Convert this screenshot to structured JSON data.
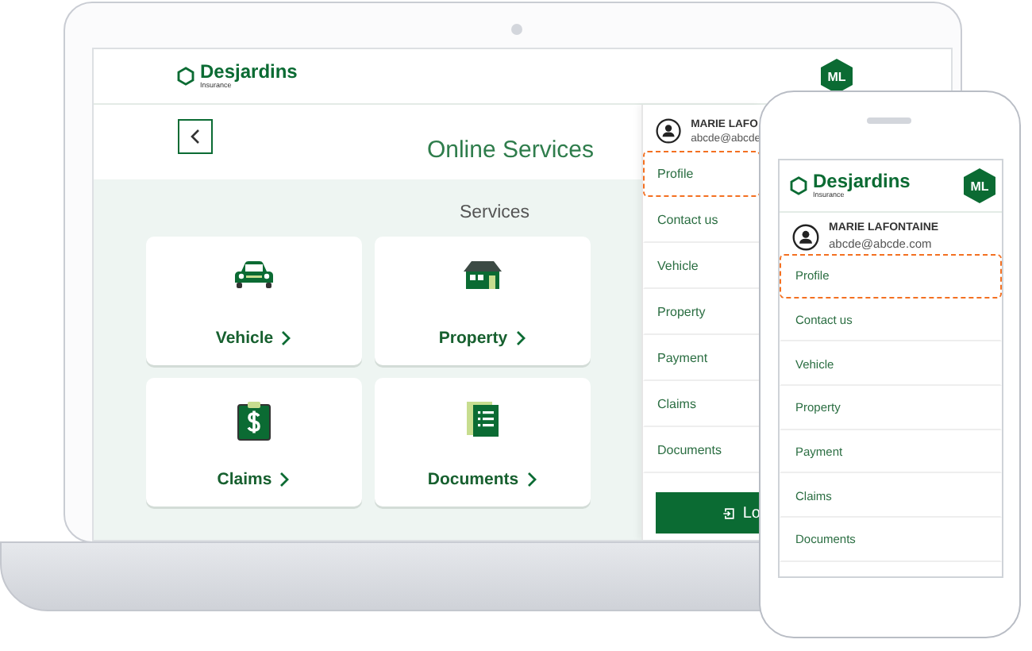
{
  "laptop": {
    "header": {
      "brand": "Desjardins",
      "tagline": "Insurance",
      "avatar": "ML"
    },
    "page_title": "Online Services",
    "section_title": "Services",
    "cards": [
      {
        "label": "Vehicle",
        "kind": "car"
      },
      {
        "label": "Property",
        "kind": "house"
      },
      {
        "label": "Claims",
        "kind": "claim"
      },
      {
        "label": "Documents",
        "kind": "document"
      }
    ],
    "menu": {
      "user_name": "MARIE LAFO",
      "email": "abcde@abcde",
      "items": [
        {
          "label": "Profile",
          "selected": true
        },
        {
          "label": "Contact us",
          "selected": false
        },
        {
          "label": "Vehicle",
          "selected": false
        },
        {
          "label": "Property",
          "selected": false
        },
        {
          "label": "Payment",
          "selected": false
        },
        {
          "label": "Claims",
          "selected": false
        },
        {
          "label": "Documents",
          "selected": false
        }
      ],
      "logout": "Lo"
    }
  },
  "phone": {
    "header": {
      "brand": "Desjardins",
      "tagline": "Insurance",
      "avatar": "ML"
    },
    "menu": {
      "user_name": "MARIE LAFONTAINE",
      "email": "abcde@abcde.com",
      "items": [
        {
          "label": "Profile",
          "selected": true
        },
        {
          "label": "Contact us",
          "selected": false
        },
        {
          "label": "Vehicle",
          "selected": false
        },
        {
          "label": "Property",
          "selected": false
        },
        {
          "label": "Payment",
          "selected": false
        },
        {
          "label": "Claims",
          "selected": false
        },
        {
          "label": "Documents",
          "selected": false
        }
      ]
    }
  }
}
